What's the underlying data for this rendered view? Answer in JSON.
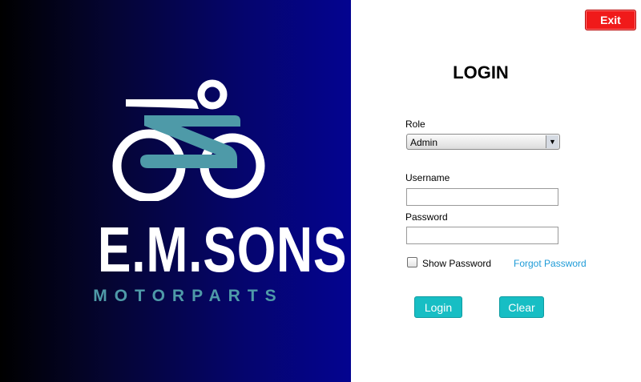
{
  "brand": {
    "name": "E.M.SONS",
    "subtitle": "MOTORPARTS",
    "logo_icon": "motorcycle-rider-icon",
    "colors": {
      "accent": "#4e9aa8",
      "background_dark": "#000000",
      "background_blue": "#04048f"
    }
  },
  "window": {
    "exit_label": "Exit",
    "exit_color": "#f01a1a"
  },
  "form": {
    "title": "LOGIN",
    "role_label": "Role",
    "role_value": "Admin",
    "role_arrow_icon": "dropdown-arrow-icon",
    "username_label": "Username",
    "username_value": "",
    "password_label": "Password",
    "password_value": "",
    "show_password_label": "Show Password",
    "show_password_checked": false,
    "forgot_password_label": "Forgot Password",
    "login_label": "Login",
    "clear_label": "Clear",
    "button_color": "#17bec4",
    "link_color": "#1e9bd7"
  }
}
